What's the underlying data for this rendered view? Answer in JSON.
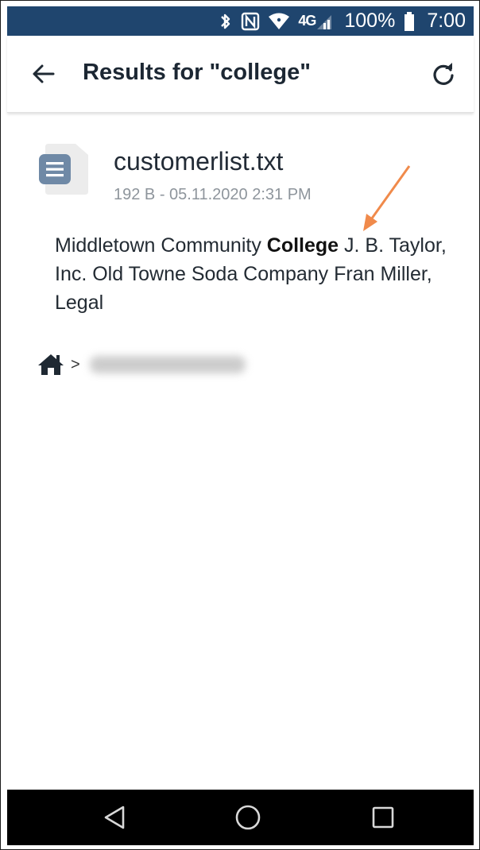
{
  "status_bar": {
    "network": "4G",
    "battery_percent": "100%",
    "time": "7:00",
    "icons": [
      "bluetooth-icon",
      "nfc-icon",
      "wifi-icon",
      "lte-signal-icon",
      "battery-icon"
    ],
    "background_color": "#1f456e"
  },
  "app_bar": {
    "title": "Results for \"college\"",
    "back_icon": "arrow-left-icon",
    "refresh_icon": "refresh-icon"
  },
  "result": {
    "file_name": "customerlist.txt",
    "meta": "192 B - 05.11.2020 2:31 PM",
    "snippet": {
      "before": "Middletown Community ",
      "highlight": "College",
      "after": " J. B. Taylor, Inc. Old Towne Soda Company Fran Miller, Legal"
    },
    "annotation_arrow_color": "#f08a4b"
  },
  "breadcrumb": {
    "home_icon": "home-icon",
    "separator": ">"
  },
  "nav_bar": {
    "buttons": [
      "back-triangle-icon",
      "home-circle-icon",
      "recents-square-icon"
    ]
  }
}
